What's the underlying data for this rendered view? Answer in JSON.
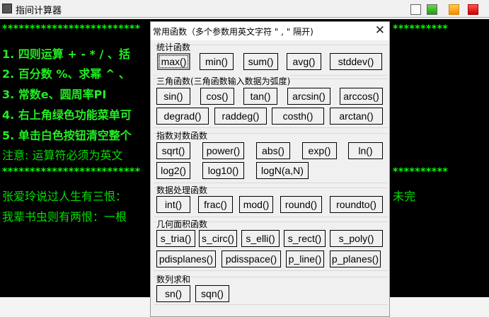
{
  "window": {
    "title": "指间计算器",
    "colors": {
      "clear": "#ffffff",
      "menu": "#33aa22",
      "orange": "#ff9900",
      "close": "#dd0000"
    }
  },
  "console": {
    "stars_left": "*************************",
    "stars_right": "**********",
    "lines": [
      "1. 四则运算 + - * / 、括",
      "2. 百分数 %、求幂 ^ 、",
      "3. 常数e、圆周率PI",
      "4. 右上角绿色功能菜单可",
      "5. 单击白色按钮清空整个",
      "注意: 运算符必须为英文"
    ],
    "stars2_left": "*************************",
    "stars2_right": "**********",
    "quote1": "张爱玲说过人生有三恨：",
    "quote1_end": "未完",
    "quote2": "我辈书虫则有两恨：一根"
  },
  "dialog": {
    "title": "常用函数（多个参数用英文字符 \" , \"  隔开)",
    "close": "✕",
    "groups": [
      {
        "label": "统计函数",
        "buttons": [
          "max()",
          "min()",
          "sum()",
          "avg()",
          "stddev()"
        ]
      },
      {
        "label": "三角函数(三角函数输入数据为弧度)",
        "buttons": [
          "sin()",
          "cos()",
          "tan()",
          "arcsin()",
          "arccos()",
          "degrad()",
          "raddeg()",
          "costh()",
          "arctan()"
        ]
      },
      {
        "label": "指数对数函数",
        "buttons": [
          "sqrt()",
          "power()",
          "abs()",
          "exp()",
          "ln()",
          "log2()",
          "log10()",
          "logN(a,N)"
        ]
      },
      {
        "label": "数据处理函数",
        "buttons": [
          "int()",
          "frac()",
          "mod()",
          "round()",
          "roundto()"
        ]
      },
      {
        "label": "几何面积函数",
        "buttons": [
          "s_tria()",
          "s_circ()",
          "s_elli()",
          "s_rect()",
          "s_poly()",
          "pdisplanes()",
          "pdisspace()",
          "p_line()",
          "p_planes()"
        ]
      },
      {
        "label": "数列求和",
        "buttons": [
          "sn()",
          "sqn()"
        ]
      }
    ]
  }
}
